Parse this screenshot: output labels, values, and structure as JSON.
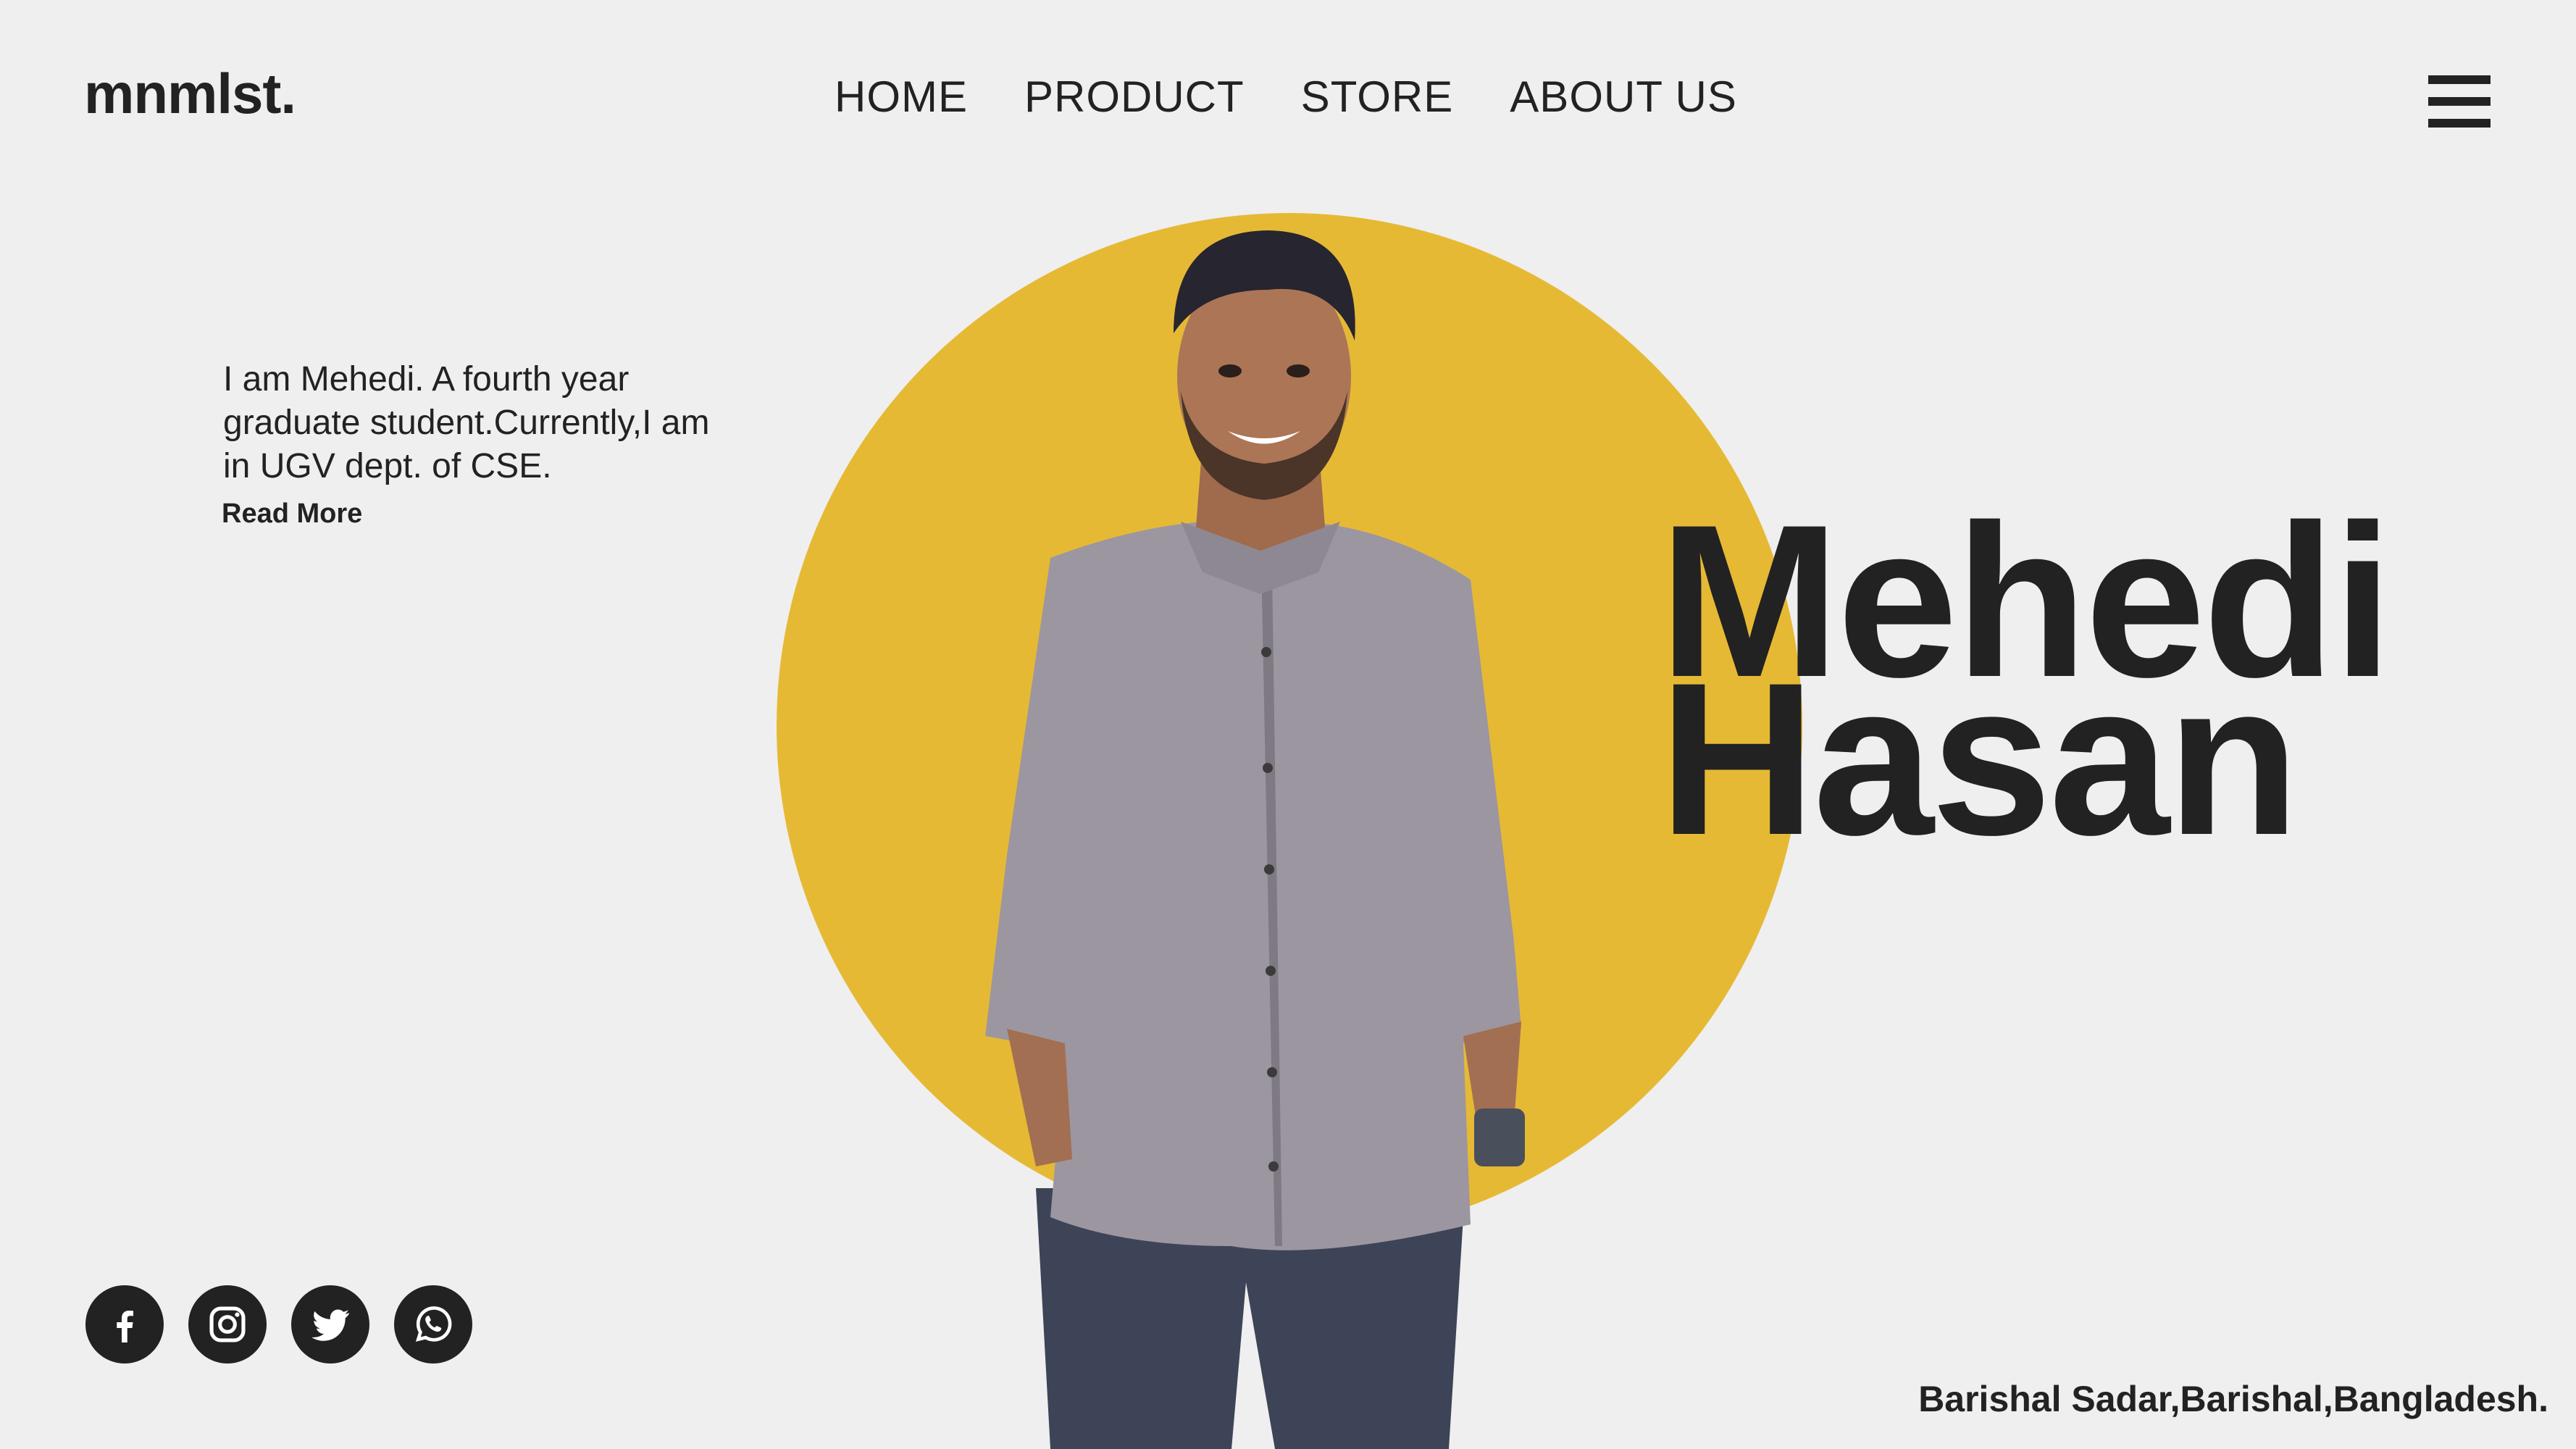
{
  "header": {
    "logo": "mnmlst.",
    "nav": [
      {
        "label": "HOME"
      },
      {
        "label": "PRODUCT"
      },
      {
        "label": "STORE"
      },
      {
        "label": "ABOUT US"
      }
    ],
    "menu_icon": "hamburger-menu-icon"
  },
  "intro": {
    "text": "I am Mehedi. A fourth year graduate student.Currently,I am in UGV dept. of CSE.",
    "read_more": "Read More"
  },
  "hero": {
    "first_name": "Mehedi",
    "last_name": "Hasan",
    "accent_color": "#e6b935",
    "photo": "portrait-photo"
  },
  "socials": [
    {
      "icon": "facebook-icon"
    },
    {
      "icon": "instagram-icon"
    },
    {
      "icon": "twitter-icon"
    },
    {
      "icon": "whatsapp-icon"
    }
  ],
  "footer": {
    "address": "Barishal Sadar,Barishal,Bangladesh."
  }
}
